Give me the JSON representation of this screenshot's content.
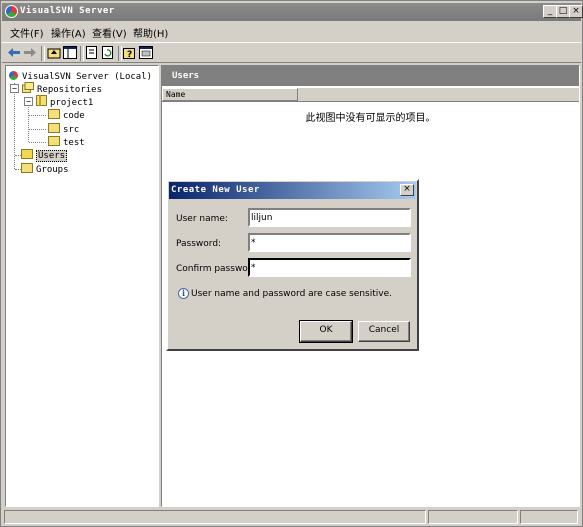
{
  "window": {
    "title": "VisualSVN Server"
  },
  "window_buttons": {
    "minimize": "_",
    "maximize": "□",
    "close": "×"
  },
  "menu": [
    {
      "label": "文件(F)"
    },
    {
      "label": "操作(A)"
    },
    {
      "label": "查看(V)"
    },
    {
      "label": "帮助(H)"
    }
  ],
  "toolbar": {
    "icons": [
      "back-arrow-icon",
      "forward-arrow-icon",
      "up-folder-icon",
      "show-hide-tree-icon",
      "export-list-icon",
      "refresh-icon",
      "help-icon",
      "properties-icon"
    ]
  },
  "tree": {
    "root": "VisualSVN Server (Local)",
    "repositories": "Repositories",
    "project": "project1",
    "children": [
      "code",
      "src",
      "test"
    ],
    "users": "Users",
    "groups": "Groups"
  },
  "right_pane": {
    "header": "Users",
    "column_name": "Name",
    "empty_message": "此视图中没有可显示的项目。"
  },
  "dialog": {
    "title": "Create New User",
    "close": "×",
    "username_label": "User name:",
    "username_value": "liljun",
    "password_label": "Password:",
    "password_value": "*",
    "confirm_label": "Confirm password:",
    "confirm_value": "*",
    "info_text": "User name and password are case sensitive.",
    "ok_label": "OK",
    "cancel_label": "Cancel"
  },
  "colors": {
    "dialog_title_start": "#0a246a",
    "dialog_title_end": "#a6caf0",
    "chrome": "#d4d0c8"
  }
}
